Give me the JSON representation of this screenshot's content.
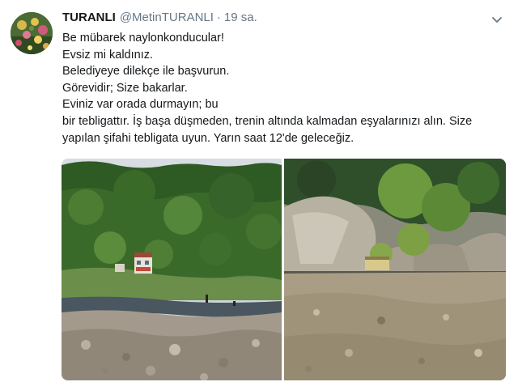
{
  "tweet": {
    "display_name": "TURANLI",
    "handle": "@MetinTURANLI",
    "separator": "·",
    "time": "19 sa.",
    "lines": [
      "Be mübarek naylonkonducular!",
      "Evsiz mi kaldınız.",
      "Belediyeye dilekçe ile başvurun.",
      "Görevidir; Size bakarlar.",
      "Eviniz var orada durmayın; bu",
      "bir tebligattır. İş başa düşmeden, trenin altında kalmadan eşyalarınızı alın. Size",
      "yapılan şifahi tebligata uyun. Yarın saat 12'de geleceğiz."
    ]
  },
  "icons": {
    "caret": "chevron-down-icon",
    "avatar": "flower-avatar"
  },
  "colors": {
    "text": "#14171a",
    "secondary": "#657786",
    "background": "#ffffff"
  }
}
